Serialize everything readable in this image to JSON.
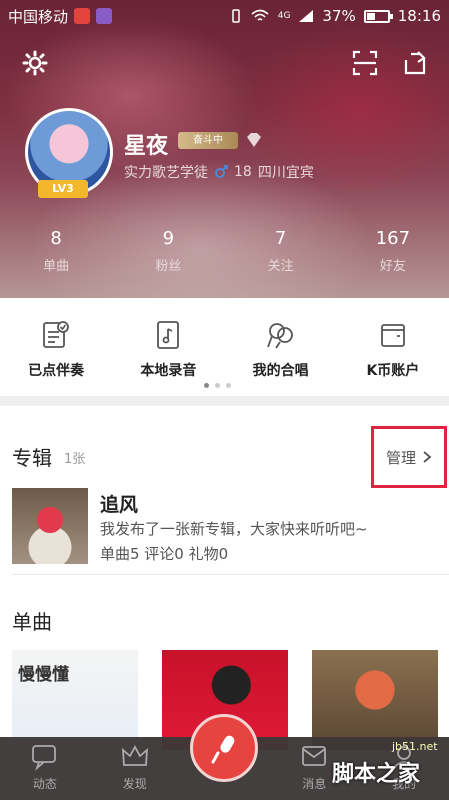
{
  "status_bar": {
    "carrier": "中国移动",
    "network": "4G",
    "battery": "37%",
    "time": "18:16"
  },
  "profile": {
    "nickname": "星夜",
    "vip_tag": "奋斗中",
    "level": "LV3",
    "title": "实力歌艺学徒",
    "age": "18",
    "location": "四川宜宾"
  },
  "stats": [
    {
      "value": "8",
      "label": "单曲"
    },
    {
      "value": "9",
      "label": "粉丝"
    },
    {
      "value": "7",
      "label": "关注"
    },
    {
      "value": "167",
      "label": "好友"
    }
  ],
  "quick_actions": [
    {
      "label": "已点伴奏",
      "icon": "accompaniment-icon"
    },
    {
      "label": "本地录音",
      "icon": "local-recording-icon"
    },
    {
      "label": "我的合唱",
      "icon": "chorus-icon"
    },
    {
      "label": "K币账户",
      "icon": "wallet-icon"
    }
  ],
  "album_section": {
    "title": "专辑",
    "count": "1张",
    "manage_label": "管理",
    "album": {
      "title": "追风",
      "description": "我发布了一张新专辑，大家快来听听吧~",
      "stats": "单曲5 评论0 礼物0"
    }
  },
  "singles_section": {
    "title": "单曲",
    "cover_1_text": "慢慢懂"
  },
  "bottom_nav": [
    {
      "label": "动态",
      "icon": "feed-icon"
    },
    {
      "label": "发现",
      "icon": "crown-icon"
    },
    {
      "label": "",
      "icon": "mic-icon"
    },
    {
      "label": "消息",
      "icon": "message-icon"
    },
    {
      "label": "我的",
      "icon": "profile-icon"
    }
  ],
  "watermark": {
    "site": "jb51.net",
    "text": "脚本之家"
  }
}
